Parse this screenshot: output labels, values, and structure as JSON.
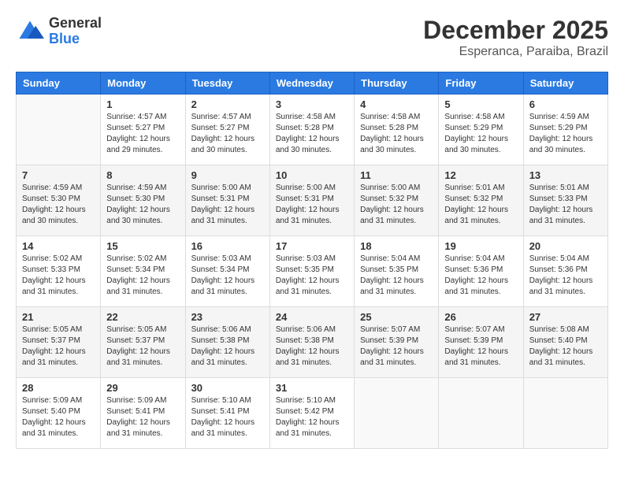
{
  "header": {
    "logo_general": "General",
    "logo_blue": "Blue",
    "month_title": "December 2025",
    "subtitle": "Esperanca, Paraiba, Brazil"
  },
  "days_of_week": [
    "Sunday",
    "Monday",
    "Tuesday",
    "Wednesday",
    "Thursday",
    "Friday",
    "Saturday"
  ],
  "weeks": [
    [
      {
        "day": "",
        "info": ""
      },
      {
        "day": "1",
        "info": "Sunrise: 4:57 AM\nSunset: 5:27 PM\nDaylight: 12 hours\nand 29 minutes."
      },
      {
        "day": "2",
        "info": "Sunrise: 4:57 AM\nSunset: 5:27 PM\nDaylight: 12 hours\nand 30 minutes."
      },
      {
        "day": "3",
        "info": "Sunrise: 4:58 AM\nSunset: 5:28 PM\nDaylight: 12 hours\nand 30 minutes."
      },
      {
        "day": "4",
        "info": "Sunrise: 4:58 AM\nSunset: 5:28 PM\nDaylight: 12 hours\nand 30 minutes."
      },
      {
        "day": "5",
        "info": "Sunrise: 4:58 AM\nSunset: 5:29 PM\nDaylight: 12 hours\nand 30 minutes."
      },
      {
        "day": "6",
        "info": "Sunrise: 4:59 AM\nSunset: 5:29 PM\nDaylight: 12 hours\nand 30 minutes."
      }
    ],
    [
      {
        "day": "7",
        "info": "Sunrise: 4:59 AM\nSunset: 5:30 PM\nDaylight: 12 hours\nand 30 minutes."
      },
      {
        "day": "8",
        "info": "Sunrise: 4:59 AM\nSunset: 5:30 PM\nDaylight: 12 hours\nand 30 minutes."
      },
      {
        "day": "9",
        "info": "Sunrise: 5:00 AM\nSunset: 5:31 PM\nDaylight: 12 hours\nand 31 minutes."
      },
      {
        "day": "10",
        "info": "Sunrise: 5:00 AM\nSunset: 5:31 PM\nDaylight: 12 hours\nand 31 minutes."
      },
      {
        "day": "11",
        "info": "Sunrise: 5:00 AM\nSunset: 5:32 PM\nDaylight: 12 hours\nand 31 minutes."
      },
      {
        "day": "12",
        "info": "Sunrise: 5:01 AM\nSunset: 5:32 PM\nDaylight: 12 hours\nand 31 minutes."
      },
      {
        "day": "13",
        "info": "Sunrise: 5:01 AM\nSunset: 5:33 PM\nDaylight: 12 hours\nand 31 minutes."
      }
    ],
    [
      {
        "day": "14",
        "info": "Sunrise: 5:02 AM\nSunset: 5:33 PM\nDaylight: 12 hours\nand 31 minutes."
      },
      {
        "day": "15",
        "info": "Sunrise: 5:02 AM\nSunset: 5:34 PM\nDaylight: 12 hours\nand 31 minutes."
      },
      {
        "day": "16",
        "info": "Sunrise: 5:03 AM\nSunset: 5:34 PM\nDaylight: 12 hours\nand 31 minutes."
      },
      {
        "day": "17",
        "info": "Sunrise: 5:03 AM\nSunset: 5:35 PM\nDaylight: 12 hours\nand 31 minutes."
      },
      {
        "day": "18",
        "info": "Sunrise: 5:04 AM\nSunset: 5:35 PM\nDaylight: 12 hours\nand 31 minutes."
      },
      {
        "day": "19",
        "info": "Sunrise: 5:04 AM\nSunset: 5:36 PM\nDaylight: 12 hours\nand 31 minutes."
      },
      {
        "day": "20",
        "info": "Sunrise: 5:04 AM\nSunset: 5:36 PM\nDaylight: 12 hours\nand 31 minutes."
      }
    ],
    [
      {
        "day": "21",
        "info": "Sunrise: 5:05 AM\nSunset: 5:37 PM\nDaylight: 12 hours\nand 31 minutes."
      },
      {
        "day": "22",
        "info": "Sunrise: 5:05 AM\nSunset: 5:37 PM\nDaylight: 12 hours\nand 31 minutes."
      },
      {
        "day": "23",
        "info": "Sunrise: 5:06 AM\nSunset: 5:38 PM\nDaylight: 12 hours\nand 31 minutes."
      },
      {
        "day": "24",
        "info": "Sunrise: 5:06 AM\nSunset: 5:38 PM\nDaylight: 12 hours\nand 31 minutes."
      },
      {
        "day": "25",
        "info": "Sunrise: 5:07 AM\nSunset: 5:39 PM\nDaylight: 12 hours\nand 31 minutes."
      },
      {
        "day": "26",
        "info": "Sunrise: 5:07 AM\nSunset: 5:39 PM\nDaylight: 12 hours\nand 31 minutes."
      },
      {
        "day": "27",
        "info": "Sunrise: 5:08 AM\nSunset: 5:40 PM\nDaylight: 12 hours\nand 31 minutes."
      }
    ],
    [
      {
        "day": "28",
        "info": "Sunrise: 5:09 AM\nSunset: 5:40 PM\nDaylight: 12 hours\nand 31 minutes."
      },
      {
        "day": "29",
        "info": "Sunrise: 5:09 AM\nSunset: 5:41 PM\nDaylight: 12 hours\nand 31 minutes."
      },
      {
        "day": "30",
        "info": "Sunrise: 5:10 AM\nSunset: 5:41 PM\nDaylight: 12 hours\nand 31 minutes."
      },
      {
        "day": "31",
        "info": "Sunrise: 5:10 AM\nSunset: 5:42 PM\nDaylight: 12 hours\nand 31 minutes."
      },
      {
        "day": "",
        "info": ""
      },
      {
        "day": "",
        "info": ""
      },
      {
        "day": "",
        "info": ""
      }
    ]
  ]
}
